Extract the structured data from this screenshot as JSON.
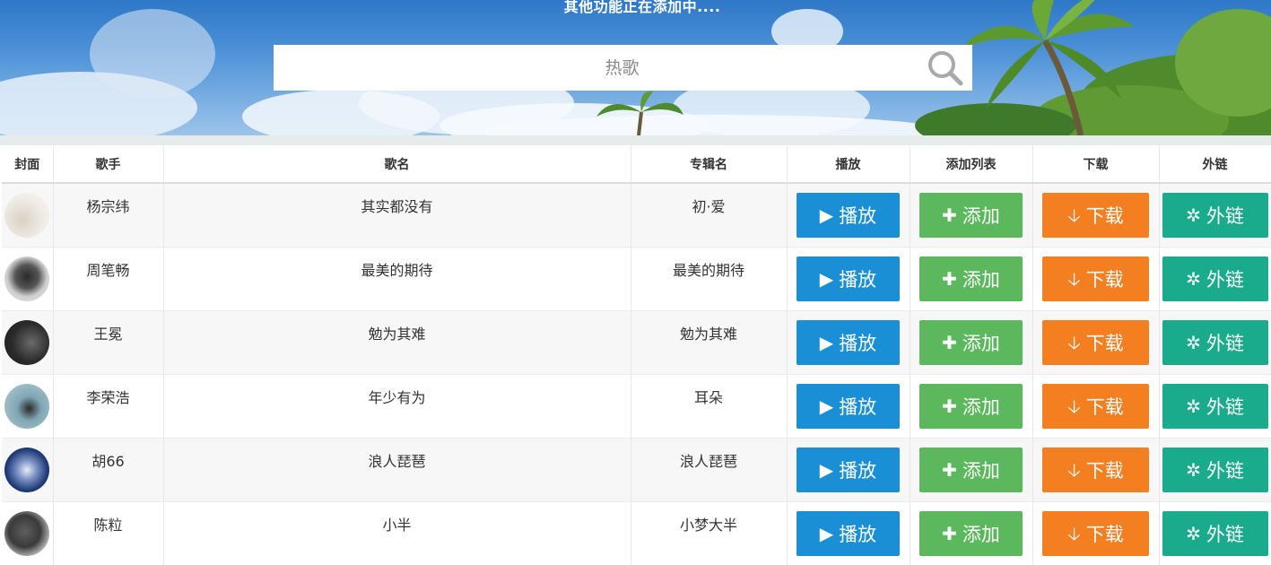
{
  "header": {
    "notice": "其他功能正在添加中....",
    "search": {
      "placeholder": "热歌",
      "value": ""
    }
  },
  "table": {
    "columns": [
      "封面",
      "歌手",
      "歌名",
      "专辑名",
      "播放",
      "添加列表",
      "下载",
      "外链"
    ],
    "actions": {
      "play_icon": "play-triangle-icon",
      "play_label": "播放",
      "add_icon": "plus-icon",
      "add_label": "添加",
      "download_icon": "arrow-down-icon",
      "download_label": "下载",
      "link_icon": "puzzle-icon",
      "link_label": "外链"
    },
    "rows": [
      {
        "singer": "杨宗纬",
        "song": "其实都没有",
        "album": "初·爱"
      },
      {
        "singer": "周笔畅",
        "song": "最美的期待",
        "album": "最美的期待"
      },
      {
        "singer": "王冕",
        "song": "勉为其难",
        "album": "勉为其难"
      },
      {
        "singer": "李荣浩",
        "song": "年少有为",
        "album": "耳朵"
      },
      {
        "singer": "胡66",
        "song": "浪人琵琶",
        "album": "浪人琵琶"
      },
      {
        "singer": "陈粒",
        "song": "小半",
        "album": "小梦大半"
      }
    ]
  },
  "colors": {
    "play": "#1a8fd6",
    "add": "#5cb85c",
    "download": "#f47f20",
    "link": "#1aab8c"
  }
}
